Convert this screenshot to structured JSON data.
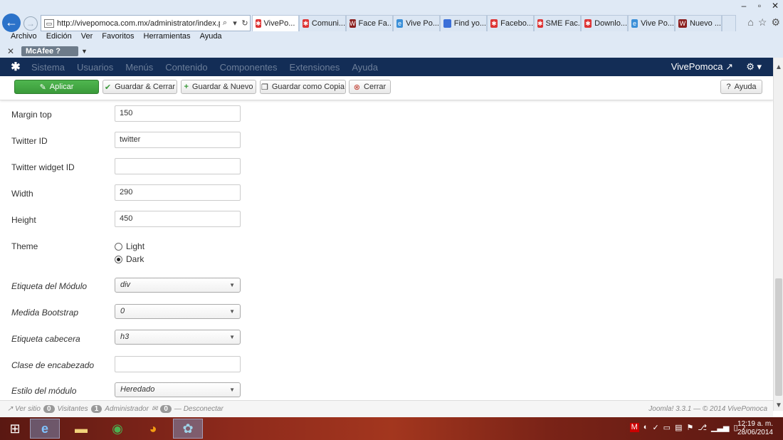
{
  "browser": {
    "url": "http://vivepomoca.com.mx/administrator/index.php?",
    "tabs": [
      {
        "label": "VivePo...",
        "active": true,
        "icon": "joomla-icon"
      },
      {
        "label": "Comuni...",
        "active": false,
        "icon": "joomla-icon"
      },
      {
        "label": "Face Fa...",
        "active": false,
        "icon": "wordpress-icon"
      },
      {
        "label": "Vive Po...",
        "active": false,
        "icon": "ie-icon"
      },
      {
        "label": "Find yo...",
        "active": false,
        "icon": "page-icon"
      },
      {
        "label": "Facebo...",
        "active": false,
        "icon": "joomla-icon"
      },
      {
        "label": "SME Fac...",
        "active": false,
        "icon": "joomla-icon"
      },
      {
        "label": "Downlo...",
        "active": false,
        "icon": "joomla-icon"
      },
      {
        "label": "Vive Po...",
        "active": false,
        "icon": "ie-icon"
      },
      {
        "label": "Nuevo ...",
        "active": false,
        "icon": "wordpress-icon"
      }
    ],
    "menu": [
      "Archivo",
      "Edición",
      "Ver",
      "Favoritos",
      "Herramientas",
      "Ayuda"
    ],
    "mcafee_label": "McAfee"
  },
  "nav": {
    "items": [
      "Sistema",
      "Usuarios",
      "Menús",
      "Contenido",
      "Componentes",
      "Extensiones",
      "Ayuda"
    ],
    "site_name": "VivePomoca"
  },
  "toolbar": {
    "apply": "Aplicar",
    "save_close": "Guardar & Cerrar",
    "save_new": "Guardar & Nuevo",
    "save_copy": "Guardar como Copia",
    "close": "Cerrar",
    "help": "Ayuda"
  },
  "form": {
    "margin_top": {
      "label": "Margin top",
      "value": "150"
    },
    "twitter_id": {
      "label": "Twitter ID",
      "value": "twitter"
    },
    "twitter_widget_id": {
      "label": "Twitter widget ID",
      "value": ""
    },
    "width": {
      "label": "Width",
      "value": "290"
    },
    "height": {
      "label": "Height",
      "value": "450"
    },
    "theme": {
      "label": "Theme",
      "options": [
        "Light",
        "Dark"
      ],
      "selected": "Dark"
    },
    "module_tag": {
      "label": "Etiqueta del Módulo",
      "value": "div"
    },
    "bootstrap_size": {
      "label": "Medida Bootstrap",
      "value": "0"
    },
    "header_tag": {
      "label": "Etiqueta cabecera",
      "value": "h3"
    },
    "header_class": {
      "label": "Clase de encabezado",
      "value": ""
    },
    "module_style": {
      "label": "Estilo del módulo",
      "value": "Heredado"
    }
  },
  "status": {
    "view_site": "Ver sitio",
    "visitors_count": "0",
    "visitors_label": "Visitantes",
    "admins_count": "1",
    "admins_label": "Administrador",
    "messages_count": "0",
    "logout": "Desconectar",
    "version": "Joomla! 3.3.1 — © 2014 VivePomoca"
  },
  "taskbar": {
    "time": "12:19 a. m.",
    "date": "28/06/2014"
  }
}
